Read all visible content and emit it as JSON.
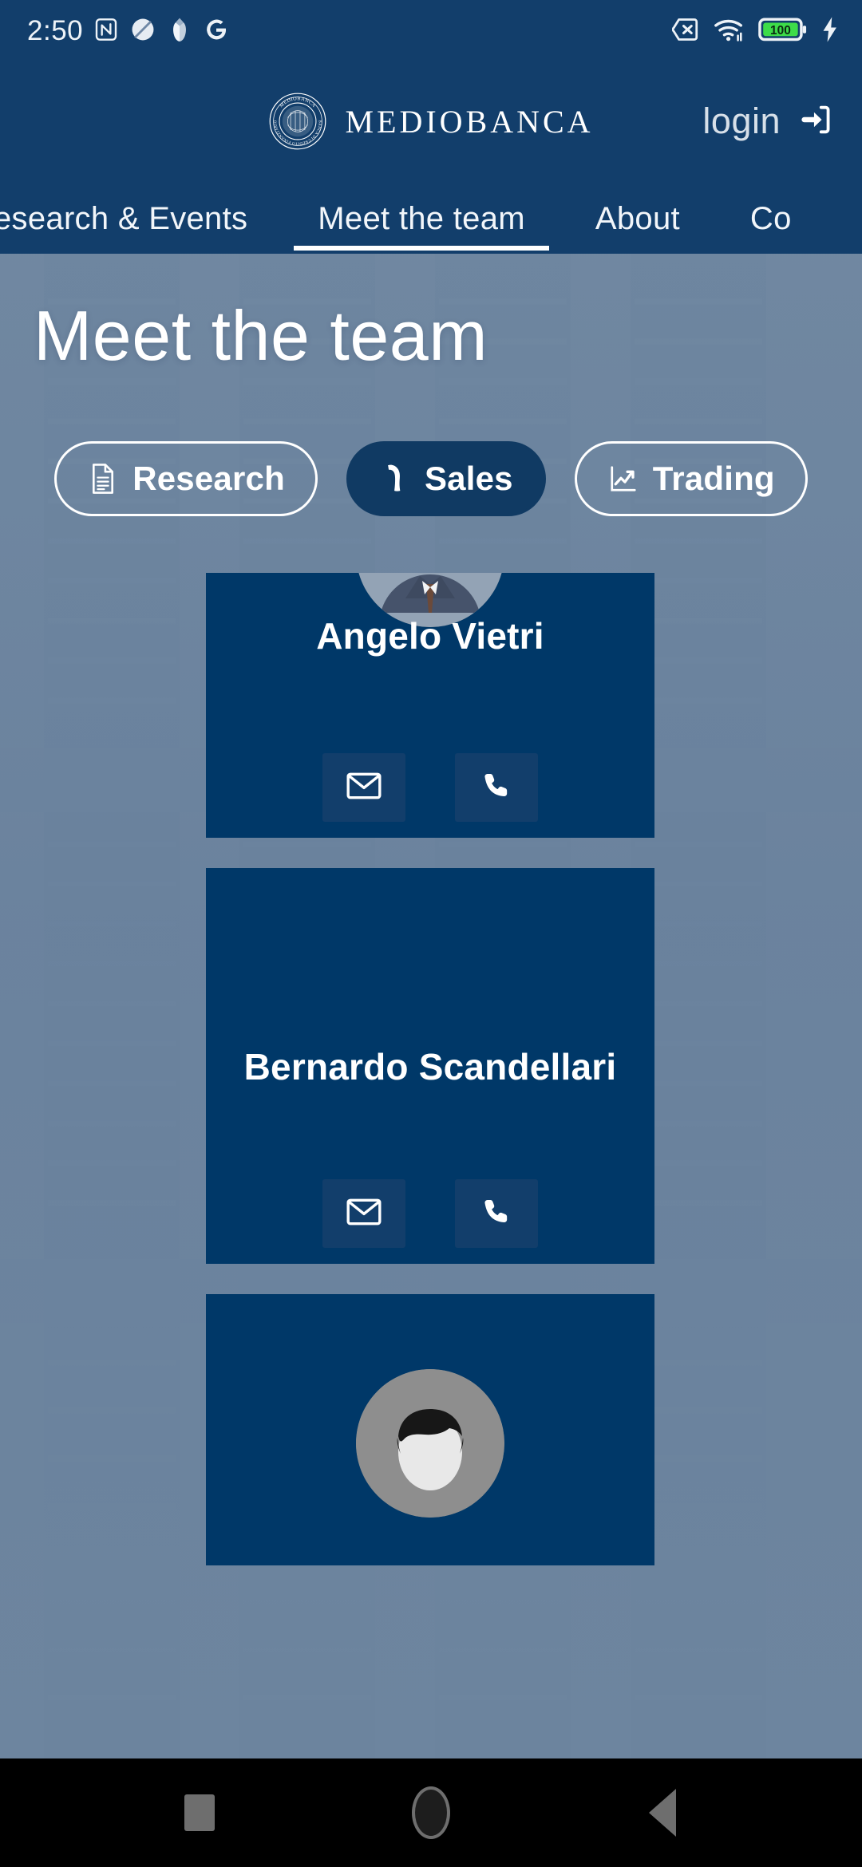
{
  "status_bar": {
    "time": "2:50",
    "left_icons": [
      "nfc-icon",
      "app-icon-circle",
      "app-icon-tulip",
      "google-icon"
    ],
    "right_icons": [
      "sim-off-icon",
      "wifi-icon",
      "battery-icon",
      "charging-bolt-icon"
    ],
    "battery_level": "100"
  },
  "site_header": {
    "logo_seal_text": "MEDIOBANCA BANCA DI CREDITO FINANZIARIO",
    "wordmark": "MEDIOBANCA",
    "login_label": "login",
    "login_icon": "sign-in-icon"
  },
  "nav": {
    "tabs": [
      {
        "label": "esearch & Events",
        "active": false
      },
      {
        "label": "Meet the team",
        "active": true
      },
      {
        "label": "About",
        "active": false
      },
      {
        "label": "Co",
        "active": false
      }
    ]
  },
  "hero": {
    "title": "Meet the team",
    "background": "blurred-building-facade"
  },
  "filters": [
    {
      "label": "Research",
      "icon": "document-icon",
      "active": false
    },
    {
      "label": "Sales",
      "icon": "phone-handset-icon",
      "active": true
    },
    {
      "label": "Trading",
      "icon": "line-chart-icon",
      "active": false
    }
  ],
  "team": {
    "members": [
      {
        "name": "Angelo Vietri",
        "email_icon": "envelope-icon",
        "phone_icon": "phone-icon",
        "avatar": "portrait-photo"
      },
      {
        "name": "Bernardo Scandellari",
        "email_icon": "envelope-icon",
        "phone_icon": "phone-icon",
        "avatar": "none"
      },
      {
        "name": "",
        "avatar": "portrait-photo"
      }
    ]
  },
  "android_nav": {
    "recents_label": "Recents",
    "home_label": "Home",
    "back_label": "Back"
  },
  "colors": {
    "header_navy": "#123E6B",
    "card_navy": "#003868",
    "hero_tint": "#6E86A0",
    "accent_white": "#FFFFFF",
    "battery_green": "#3DDC49"
  }
}
